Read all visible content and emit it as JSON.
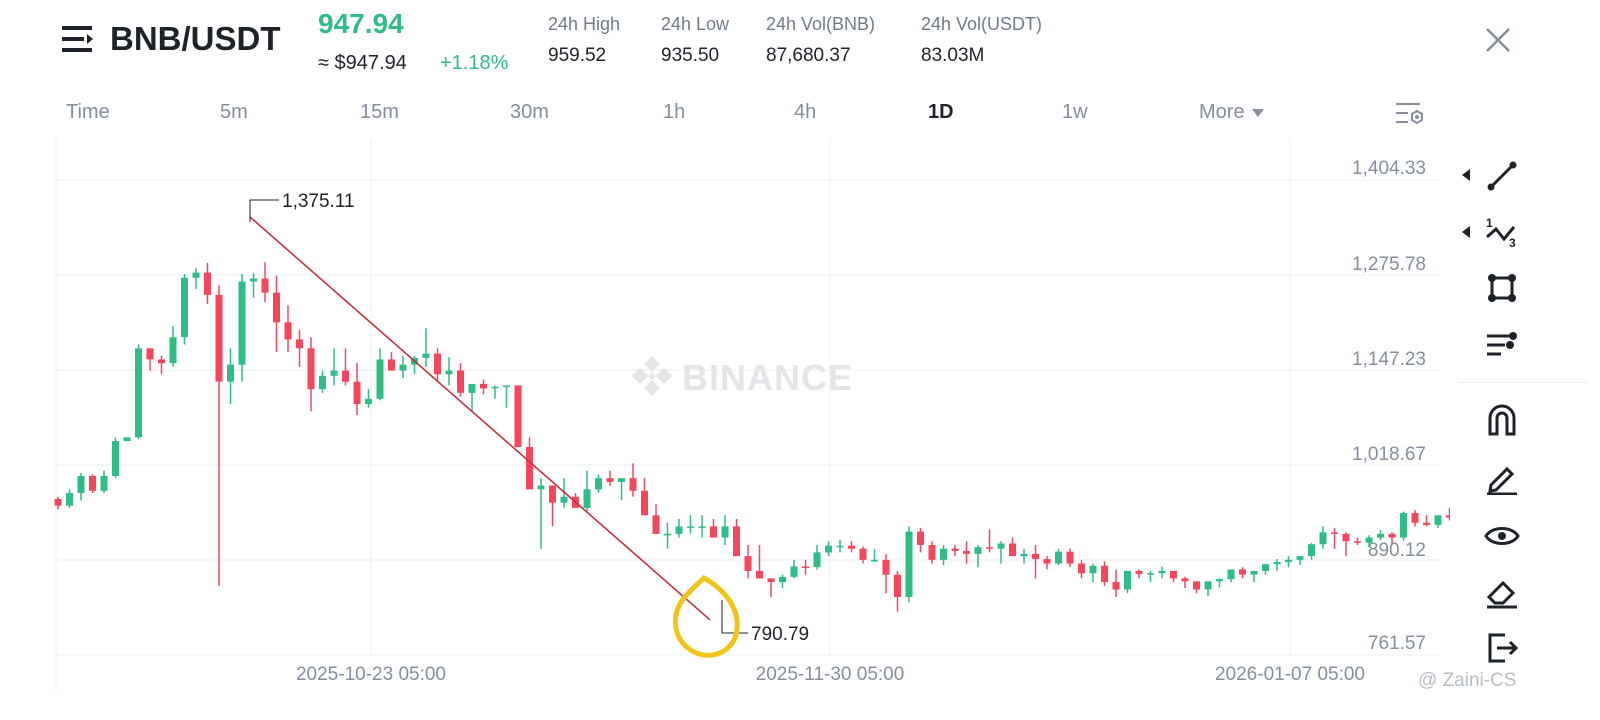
{
  "header": {
    "pair": "BNB/USDT",
    "last_price": "947.94",
    "usd_price": "≈ $947.94",
    "change": "+1.18%",
    "stats": [
      {
        "label": "24h High",
        "value": "959.52"
      },
      {
        "label": "24h Low",
        "value": "935.50"
      },
      {
        "label": "24h Vol(BNB)",
        "value": "87,680.37"
      },
      {
        "label": "24h Vol(USDT)",
        "value": "83.03M"
      }
    ]
  },
  "timeframes": {
    "items": [
      "Time",
      "5m",
      "15m",
      "30m",
      "1h",
      "4h",
      "1D",
      "1w"
    ],
    "active": "1D",
    "more_label": "More"
  },
  "watermark": "BINANCE",
  "credit": "@ Zaini-CS",
  "colors": {
    "up": "#2ebd85",
    "down": "#f6465d",
    "accent": "#2ebd85",
    "trendline": "#c8303e",
    "highlight": "#f0c419"
  },
  "icons": [
    "menu-icon",
    "close-icon",
    "chart-settings-icon",
    "line-tool-icon",
    "fib-tool-icon",
    "shape-tool-icon",
    "text-tool-icon",
    "magnet-icon",
    "pencil-icon",
    "eye-icon",
    "eraser-icon",
    "exit-icon"
  ],
  "chart_data": {
    "type": "candlestick",
    "interval": "1D",
    "y_ticks": [
      "1,404.33",
      "1,275.78",
      "1,147.23",
      "1,018.67",
      "890.12",
      "761.57"
    ],
    "ylim": [
      761.57,
      1404.33
    ],
    "x_ticks": [
      "2025-10-23 05:00",
      "2025-11-30 05:00",
      "2026-01-07 05:00"
    ],
    "annotations": {
      "high": "1,375.11",
      "low": "790.79"
    },
    "trendline": {
      "from": 1337,
      "to": 794
    },
    "candles": [
      [
        957,
        960,
        943,
        948
      ],
      [
        948,
        970,
        945,
        965
      ],
      [
        965,
        992,
        955,
        988
      ],
      [
        988,
        990,
        965,
        968
      ],
      [
        968,
        995,
        965,
        988
      ],
      [
        988,
        1040,
        985,
        1035
      ],
      [
        1035,
        1040,
        1038,
        1040
      ],
      [
        1040,
        1165,
        1038,
        1160
      ],
      [
        1160,
        1150,
        1130,
        1145
      ],
      [
        1145,
        1150,
        1125,
        1140
      ],
      [
        1140,
        1190,
        1135,
        1175
      ],
      [
        1175,
        1260,
        1165,
        1255
      ],
      [
        1255,
        1268,
        1240,
        1262
      ],
      [
        1262,
        1275,
        1220,
        1232
      ],
      [
        1232,
        1245,
        840,
        1115
      ],
      [
        1115,
        1160,
        1085,
        1138
      ],
      [
        1138,
        1260,
        1115,
        1250
      ],
      [
        1250,
        1262,
        1228,
        1254
      ],
      [
        1254,
        1276,
        1222,
        1235
      ],
      [
        1235,
        1258,
        1155,
        1195
      ],
      [
        1195,
        1218,
        1155,
        1172
      ],
      [
        1172,
        1185,
        1135,
        1160
      ],
      [
        1160,
        1175,
        1075,
        1105
      ],
      [
        1105,
        1130,
        1100,
        1123
      ],
      [
        1123,
        1160,
        1110,
        1130
      ],
      [
        1130,
        1160,
        1110,
        1115
      ],
      [
        1115,
        1140,
        1070,
        1085
      ],
      [
        1085,
        1105,
        1080,
        1092
      ],
      [
        1092,
        1160,
        1090,
        1145
      ],
      [
        1145,
        1155,
        1130,
        1130
      ],
      [
        1130,
        1150,
        1120,
        1138
      ],
      [
        1138,
        1150,
        1125,
        1147
      ],
      [
        1147,
        1187,
        1135,
        1153
      ],
      [
        1153,
        1160,
        1115,
        1125
      ],
      [
        1125,
        1148,
        1110,
        1130
      ],
      [
        1130,
        1140,
        1095,
        1100
      ],
      [
        1100,
        1108,
        1075,
        1112
      ],
      [
        1112,
        1118,
        1098,
        1106
      ],
      [
        1106,
        1110,
        1092,
        1108
      ],
      [
        1108,
        1102,
        1080,
        1110
      ],
      [
        1110,
        1106,
        1052,
        1027
      ],
      [
        1027,
        1040,
        980,
        970
      ],
      [
        970,
        985,
        890,
        975
      ],
      [
        975,
        935,
        920,
        952
      ],
      [
        952,
        985,
        945,
        960
      ],
      [
        960,
        965,
        945,
        945
      ],
      [
        945,
        995,
        940,
        970
      ],
      [
        970,
        990,
        965,
        985
      ],
      [
        985,
        995,
        975,
        980
      ],
      [
        980,
        980,
        955,
        985
      ],
      [
        985,
        1005,
        960,
        968
      ],
      [
        968,
        985,
        945,
        935
      ],
      [
        935,
        950,
        920,
        910
      ],
      [
        910,
        925,
        890,
        910
      ],
      [
        910,
        930,
        905,
        920
      ],
      [
        920,
        935,
        910,
        920
      ],
      [
        920,
        935,
        905,
        920
      ],
      [
        920,
        930,
        905,
        905
      ],
      [
        905,
        935,
        895,
        920
      ],
      [
        920,
        930,
        885,
        880
      ],
      [
        880,
        895,
        850,
        860
      ],
      [
        860,
        895,
        870,
        850
      ],
      [
        850,
        850,
        825,
        845
      ],
      [
        845,
        855,
        837,
        852
      ],
      [
        852,
        875,
        850,
        866
      ],
      [
        866,
        875,
        855,
        865
      ],
      [
        865,
        895,
        862,
        885
      ],
      [
        885,
        900,
        880,
        894
      ],
      [
        894,
        902,
        885,
        894
      ],
      [
        894,
        900,
        885,
        890
      ],
      [
        890,
        893,
        870,
        875
      ],
      [
        875,
        890,
        872,
        875
      ],
      [
        875,
        883,
        830,
        855
      ],
      [
        855,
        860,
        805,
        825
      ],
      [
        825,
        920,
        818,
        913
      ],
      [
        913,
        918,
        885,
        895
      ],
      [
        895,
        900,
        870,
        875
      ],
      [
        875,
        895,
        868,
        890
      ],
      [
        890,
        895,
        880,
        887
      ],
      [
        887,
        900,
        870,
        883
      ],
      [
        883,
        895,
        865,
        892
      ],
      [
        892,
        916,
        885,
        890
      ],
      [
        890,
        900,
        870,
        897
      ],
      [
        897,
        905,
        880,
        880
      ],
      [
        880,
        890,
        870,
        883
      ],
      [
        883,
        895,
        850,
        876
      ],
      [
        876,
        880,
        862,
        870
      ],
      [
        870,
        890,
        868,
        886
      ],
      [
        886,
        890,
        865,
        870
      ],
      [
        870,
        875,
        850,
        857
      ],
      [
        857,
        870,
        845,
        867
      ],
      [
        867,
        873,
        840,
        845
      ],
      [
        845,
        862,
        825,
        835
      ],
      [
        835,
        858,
        830,
        860
      ],
      [
        860,
        862,
        850,
        856
      ],
      [
        856,
        860,
        845,
        857
      ],
      [
        857,
        866,
        850,
        860
      ],
      [
        860,
        860,
        845,
        850
      ],
      [
        850,
        852,
        837,
        846
      ],
      [
        846,
        846,
        830,
        835
      ],
      [
        835,
        840,
        826,
        846
      ],
      [
        846,
        850,
        838,
        849
      ],
      [
        849,
        860,
        845,
        862
      ],
      [
        862,
        865,
        850,
        855
      ],
      [
        855,
        860,
        845,
        860
      ],
      [
        860,
        865,
        855,
        869
      ],
      [
        869,
        876,
        860,
        872
      ],
      [
        872,
        880,
        865,
        875
      ],
      [
        875,
        880,
        868,
        880
      ],
      [
        880,
        898,
        875,
        896
      ],
      [
        896,
        920,
        890,
        912
      ],
      [
        912,
        918,
        890,
        910
      ],
      [
        910,
        912,
        880,
        900
      ],
      [
        900,
        905,
        895,
        898
      ],
      [
        898,
        908,
        892,
        905
      ],
      [
        905,
        915,
        902,
        910
      ],
      [
        910,
        912,
        895,
        905
      ],
      [
        905,
        940,
        900,
        938
      ],
      [
        938,
        942,
        920,
        925
      ],
      [
        925,
        935,
        920,
        922
      ],
      [
        922,
        935,
        918,
        935
      ],
      [
        935,
        945,
        928,
        932
      ],
      [
        932,
        944,
        930,
        940
      ]
    ]
  }
}
